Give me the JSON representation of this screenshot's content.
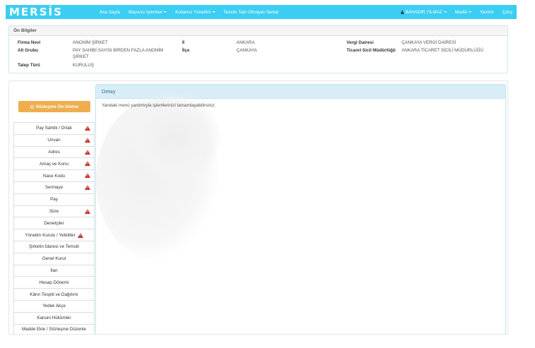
{
  "navbar": {
    "logo": "MERSİS",
    "items": [
      {
        "label": "Ana Sayfa",
        "dropdown": false
      },
      {
        "label": "Başvuru İşlemleri",
        "dropdown": true
      },
      {
        "label": "Kullanıcı Yönetimi",
        "dropdown": true
      },
      {
        "label": "Tescile Tabi Olmayan İlanlar",
        "dropdown": false
      }
    ],
    "user": "BAHADIR YILMAZ",
    "modul": "Modül",
    "help": "Yardım",
    "logout": "Çıkış",
    "color": "#3ccef2"
  },
  "info": {
    "heading": "Ön Bilgiler",
    "firma_nevi_label": "Firma Nevi",
    "firma_nevi": "ANONİM ŞİRKET",
    "alt_grubu_label": "Alt Grubu",
    "alt_grubu": "PAY SAHİBİ SAYISI BİRDEN FAZLA ANONİM ŞİRKET",
    "talep_turu_label": "Talep Türü",
    "talep_turu": "KURULUŞ",
    "il_label": "İl",
    "il": "ANKARA",
    "ilce_label": "İlçe",
    "ilce": "ÇANKAYA",
    "vergi_dairesi_label": "Vergi Dairesi",
    "vergi_dairesi": "ÇANKAYA VERGİ DAİRESİ",
    "ticaret_sicil_label": "Ticaret Sicil Müdürlüğü",
    "ticaret_sicil": "ANKARA TİCARET SİCİLİ MÜDÜRLÜĞÜ"
  },
  "sidebar": {
    "preview_button": "Sözleşme Ön İzleme",
    "items": [
      {
        "label": "Pay Sahibi / Ortak",
        "warning": true
      },
      {
        "label": "Unvan",
        "warning": true
      },
      {
        "label": "Adres",
        "warning": true
      },
      {
        "label": "Amaç ve Konu",
        "warning": true
      },
      {
        "label": "Nace Kodu",
        "warning": true
      },
      {
        "label": "Sermaye",
        "warning": true
      },
      {
        "label": "Pay",
        "warning": false
      },
      {
        "label": "Süre",
        "warning": true
      },
      {
        "label": "Denetçiler",
        "warning": false
      },
      {
        "label": "Yönetim Kurulu / Yetkililer",
        "warning": true,
        "inline": true
      },
      {
        "label": "Şirketin İdaresi ve Temsili",
        "warning": false
      },
      {
        "label": "Genel Kurul",
        "warning": false
      },
      {
        "label": "İlan",
        "warning": false
      },
      {
        "label": "Hesap Dönemi",
        "warning": false
      },
      {
        "label": "Kârın Tespiti ve Dağıtımı",
        "warning": false
      },
      {
        "label": "Yedek Akçe",
        "warning": false
      },
      {
        "label": "Kanuni Hükümler",
        "warning": false
      },
      {
        "label": "Madde Ekle / Sözleşme Düzenle",
        "warning": false
      }
    ],
    "warning_color": "#c9302c",
    "button_color": "#f0ad4e"
  },
  "detail": {
    "heading": "Detay",
    "message": "Yandaki menü yardımıyla işlemlerinizi tamamlayabilirsiniz."
  }
}
